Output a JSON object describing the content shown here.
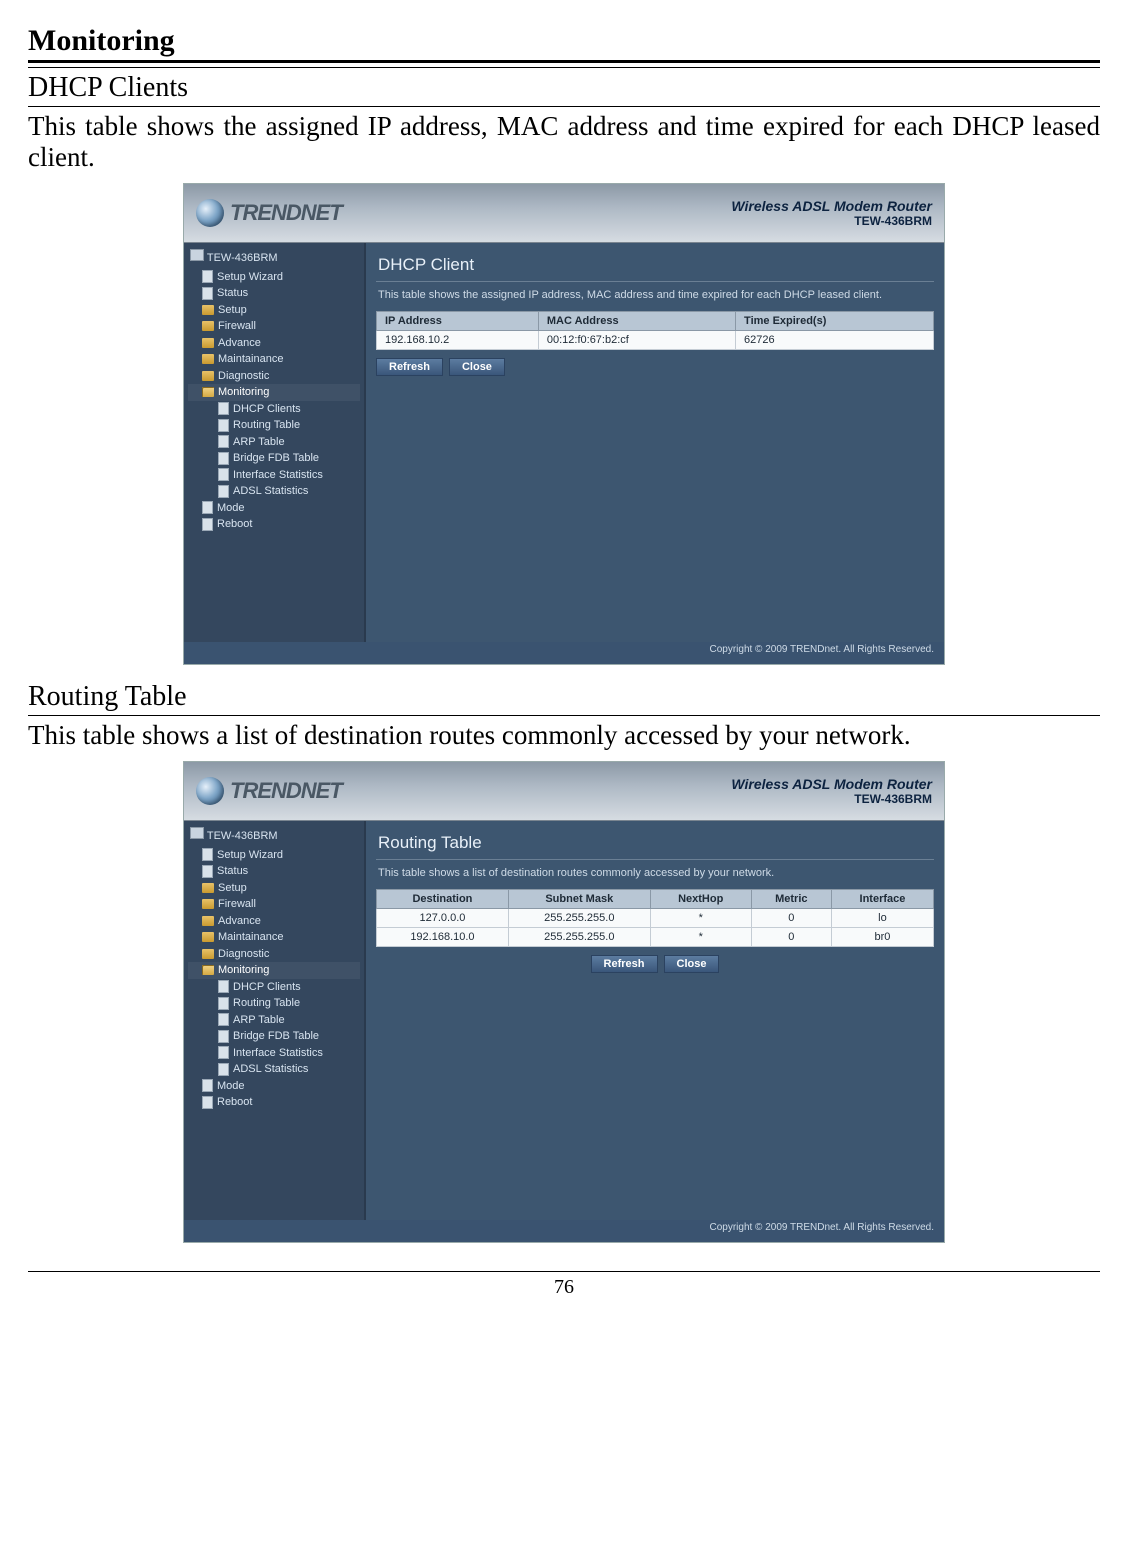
{
  "page": {
    "heading": "Monitoring",
    "section1": {
      "title": "DHCP Clients",
      "paragraph": "This table shows the assigned IP address, MAC address and time expired for each DHCP leased client."
    },
    "section2": {
      "title": "Routing Table",
      "paragraph": "This table shows a list of destination routes commonly accessed by your network."
    },
    "footer_page_number": "76"
  },
  "router": {
    "brand": "TRENDNET",
    "product_line1": "Wireless ADSL Modem Router",
    "product_line2": "TEW-436BRM",
    "copyright": "Copyright © 2009 TRENDnet. All Rights Reserved."
  },
  "sidebar": {
    "root": "TEW-436BRM",
    "items": [
      {
        "label": "Setup Wizard",
        "icon": "page"
      },
      {
        "label": "Status",
        "icon": "page"
      },
      {
        "label": "Setup",
        "icon": "folder"
      },
      {
        "label": "Firewall",
        "icon": "folder"
      },
      {
        "label": "Advance",
        "icon": "folder"
      },
      {
        "label": "Maintainance",
        "icon": "folder"
      },
      {
        "label": "Diagnostic",
        "icon": "folder"
      },
      {
        "label": "Monitoring",
        "icon": "folder-open",
        "active": true
      }
    ],
    "sub_monitoring": [
      {
        "label": "DHCP Clients"
      },
      {
        "label": "Routing Table"
      },
      {
        "label": "ARP Table"
      },
      {
        "label": "Bridge FDB Table"
      },
      {
        "label": "Interface Statistics"
      },
      {
        "label": "ADSL Statistics"
      }
    ],
    "trailing": [
      {
        "label": "Mode",
        "icon": "page"
      },
      {
        "label": "Reboot",
        "icon": "page"
      }
    ]
  },
  "dhcp_panel": {
    "title": "DHCP Client",
    "desc": "This table shows the assigned IP address, MAC address and time expired for each DHCP leased client.",
    "headers": {
      "c1": "IP Address",
      "c2": "MAC Address",
      "c3": "Time Expired(s)"
    },
    "rows": [
      {
        "c1": "192.168.10.2",
        "c2": "00:12:f0:67:b2:cf",
        "c3": "62726"
      }
    ],
    "buttons": {
      "b1": "Refresh",
      "b2": "Close"
    }
  },
  "routing_panel": {
    "title": "Routing Table",
    "desc": "This table shows a list of destination routes commonly accessed by your network.",
    "headers": {
      "c1": "Destination",
      "c2": "Subnet Mask",
      "c3": "NextHop",
      "c4": "Metric",
      "c5": "Interface"
    },
    "rows": [
      {
        "c1": "127.0.0.0",
        "c2": "255.255.255.0",
        "c3": "*",
        "c4": "0",
        "c5": "lo"
      },
      {
        "c1": "192.168.10.0",
        "c2": "255.255.255.0",
        "c3": "*",
        "c4": "0",
        "c5": "br0"
      }
    ],
    "buttons": {
      "b1": "Refresh",
      "b2": "Close"
    }
  }
}
